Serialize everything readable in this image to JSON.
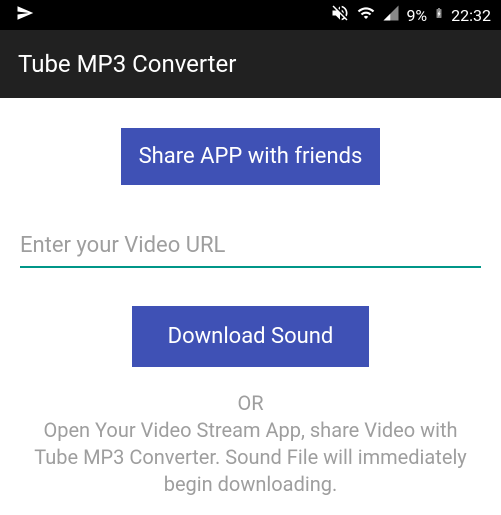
{
  "status_bar": {
    "battery_percent": "9%",
    "time": "22:32"
  },
  "app_bar": {
    "title": "Tube MP3 Converter"
  },
  "content": {
    "share_label": "Share APP with friends",
    "url_placeholder": "Enter your Video URL",
    "download_label": "Download Sound",
    "or_label": "OR",
    "instruction": "Open Your Video Stream App, share Video with Tube MP3 Converter. Sound File will immediately begin downloading."
  }
}
